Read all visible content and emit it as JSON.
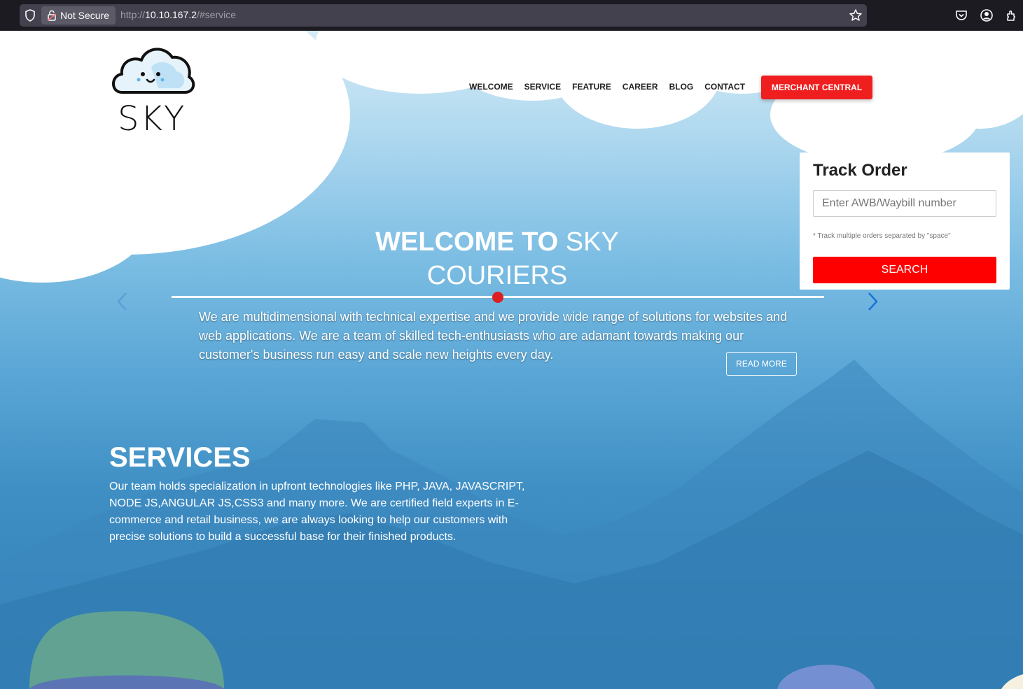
{
  "browser": {
    "security_label": "Not Secure",
    "url_scheme": "http://",
    "url_host": "10.10.167.2",
    "url_path": "/#service"
  },
  "site": {
    "logo_text": "SKY"
  },
  "nav": {
    "items": [
      "WELCOME",
      "SERVICE",
      "FEATURE",
      "CAREER",
      "BLOG",
      "CONTACT"
    ],
    "merchant_label": "MERCHANT CENTRAL"
  },
  "track": {
    "title": "Track Order",
    "placeholder": "Enter AWB/Waybill number",
    "note": "* Track multiple orders separated by \"space\"",
    "search_label": "SEARCH"
  },
  "hero": {
    "title_bold": "WELCOME TO",
    "title_light_1": "SKY",
    "title_light_2": "COURIERS",
    "text": "We are multidimensional with technical expertise and we provide wide range of solutions for websites and web applications. We are a team of skilled tech-enthusiasts who are adamant towards making our customer's business run easy and scale new heights every day.",
    "read_more": "READ MORE"
  },
  "services": {
    "title": "SERVICES",
    "text": "Our team holds specialization in upfront technologies like PHP, JAVA, JAVASCRIPT, NODE JS,ANGULAR JS,CSS3 and many more. We are certified field experts in E-commerce and retail business, we are always looking to help our customers with precise solutions to build a successful base for their finished products."
  }
}
